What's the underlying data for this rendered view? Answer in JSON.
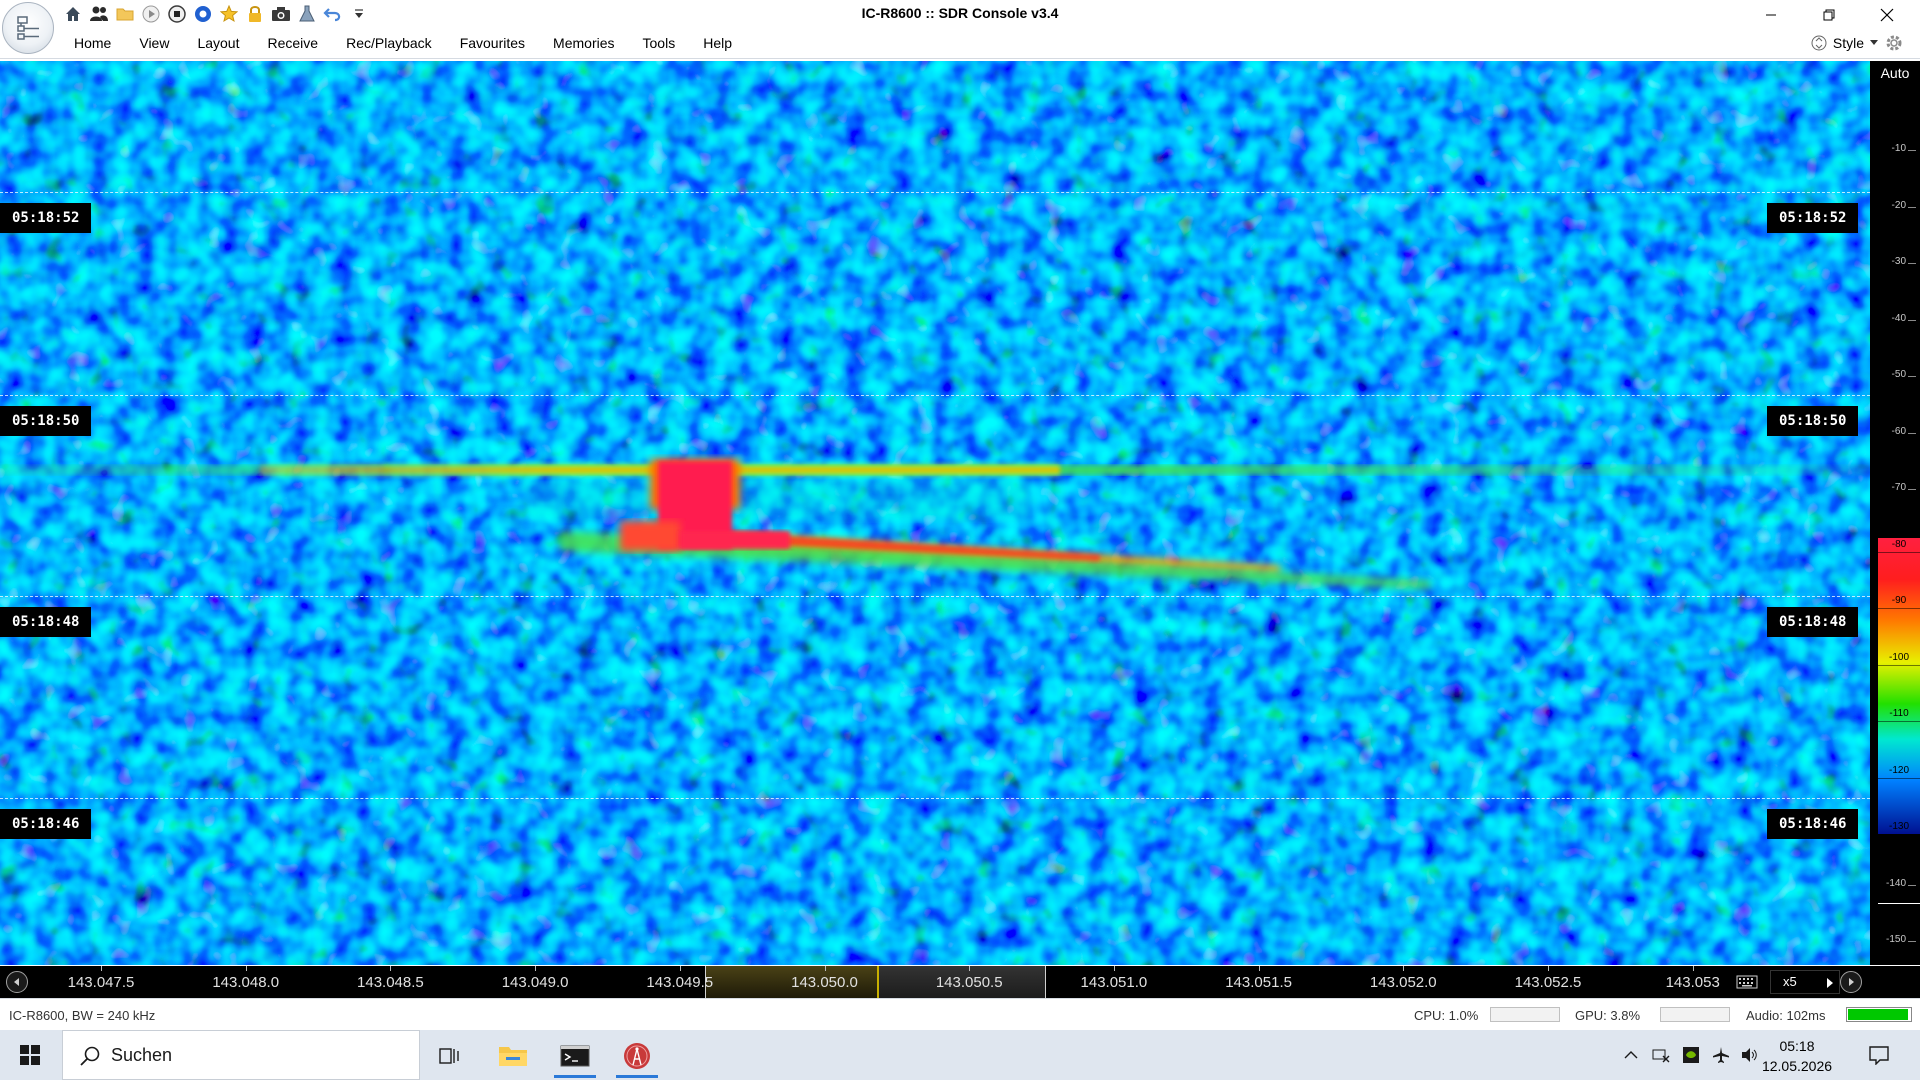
{
  "window": {
    "title": "IC-R8600 :: SDR Console v3.4",
    "minimize_glyph": "—",
    "close_glyph": "✕"
  },
  "quick_access": {
    "icons": [
      "home-icon",
      "users-icon",
      "folder-icon",
      "play-icon",
      "stop-icon",
      "record-icon",
      "star-icon",
      "lock-icon",
      "camera-icon",
      "flask-icon",
      "undo-icon",
      "dropdown-icon"
    ]
  },
  "menu": {
    "items": [
      "Home",
      "View",
      "Layout",
      "Receive",
      "Rec/Playback",
      "Favourites",
      "Memories",
      "Tools",
      "Help"
    ],
    "style_label": "Style"
  },
  "waterfall": {
    "time_markers": [
      "05:18:52",
      "05:18:50",
      "05:18:48",
      "05:18:46"
    ],
    "colors": {
      "background": "#1040e0",
      "signal_peak": "#ff1e50"
    }
  },
  "db_scale": {
    "auto_label": "Auto",
    "ticks": [
      "-10",
      "-20",
      "-30",
      "-40",
      "-50",
      "-60",
      "-70",
      "-80",
      "-90",
      "-100",
      "-110",
      "-120",
      "-130",
      "-140",
      "-150"
    ]
  },
  "freq_axis": {
    "labels": [
      "143.047.5",
      "143.048.0",
      "143.048.5",
      "143.049.0",
      "143.049.5",
      "143.050.0",
      "143.050.5",
      "143.051.0",
      "143.051.5",
      "143.052.0",
      "143.052.5",
      "143.053"
    ],
    "zoom": "x5"
  },
  "status": {
    "device": "IC-R8600, BW = 240 kHz",
    "cpu": "CPU: 1.0%",
    "gpu": "GPU: 3.8%",
    "audio": "Audio: 102ms",
    "audio_level_fraction": 0.96,
    "colors": {
      "audio_level": "#00c800"
    }
  },
  "taskbar": {
    "search_placeholder": "Suchen",
    "time": "05:18",
    "date": "12.05.2026"
  }
}
